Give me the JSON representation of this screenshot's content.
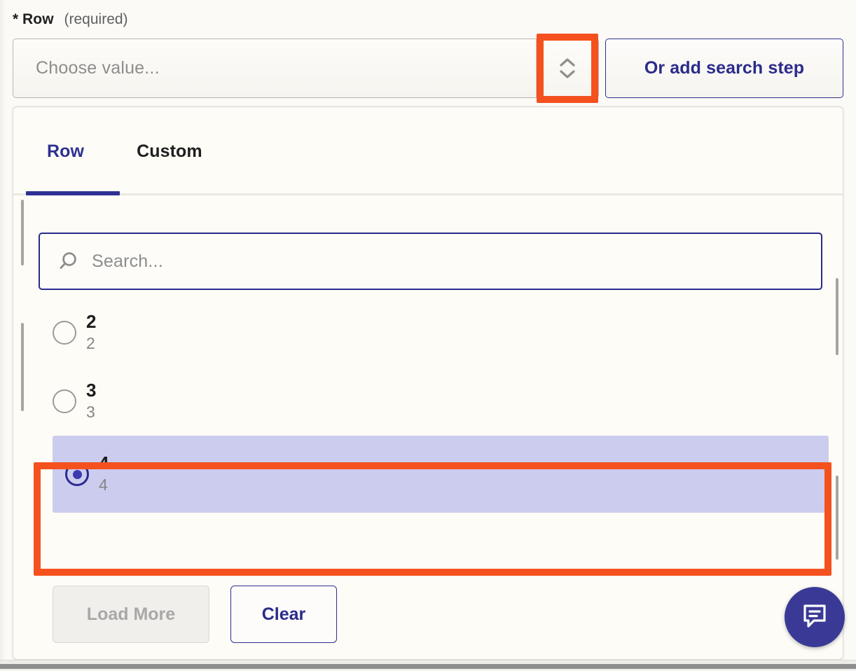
{
  "field": {
    "required_star": "*",
    "label": "Row",
    "required_note": "(required)"
  },
  "select": {
    "placeholder": "Choose value...",
    "value": "",
    "toggle_icon": "chevron-up-down-icon"
  },
  "actions": {
    "add_search_step_label": "Or add search step"
  },
  "dropdown": {
    "tabs": [
      {
        "label": "Row",
        "active": true
      },
      {
        "label": "Custom",
        "active": false
      }
    ],
    "search": {
      "placeholder": "Search...",
      "value": "",
      "icon": "search-icon"
    },
    "options": [
      {
        "title": "2",
        "subtitle": "2",
        "selected": false
      },
      {
        "title": "3",
        "subtitle": "3",
        "selected": false
      },
      {
        "title": "4",
        "subtitle": "4",
        "selected": true
      }
    ],
    "footer": {
      "load_more_label": "Load More",
      "load_more_disabled": true,
      "clear_label": "Clear"
    }
  },
  "chat": {
    "icon": "chat-bubble-icon"
  },
  "colors": {
    "accent_navy": "#2e3192",
    "annotation_orange": "#f4511e",
    "selected_row_bg": "#ccccee",
    "page_bg": "#fbfaf6",
    "panel_bg": "#fdfcf7",
    "muted_text": "#8d8d8d"
  }
}
